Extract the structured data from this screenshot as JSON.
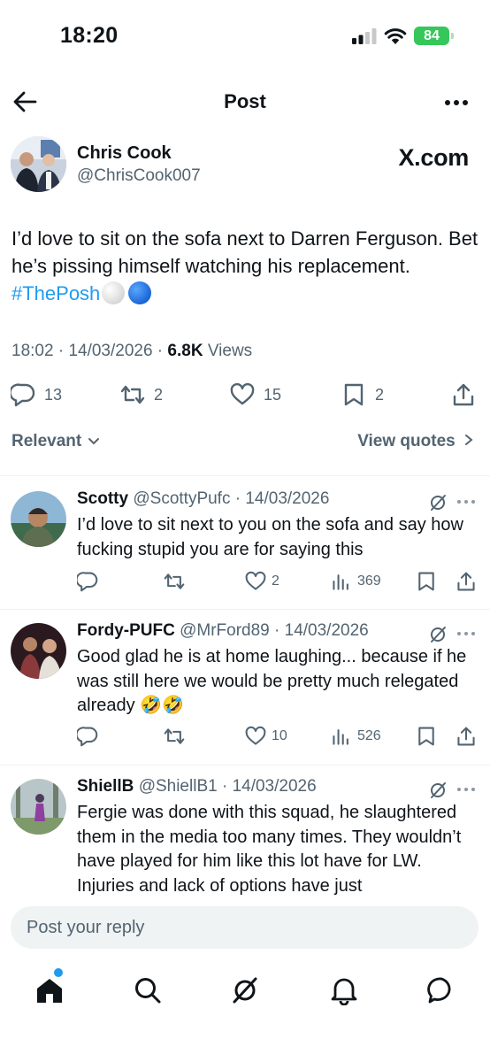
{
  "status_bar": {
    "time": "18:20",
    "battery": "84"
  },
  "header": {
    "title": "Post"
  },
  "post": {
    "author_name": "Chris Cook",
    "author_handle": "@ChrisCook007",
    "brand": "X.com",
    "text_main": "I’d love to sit on the sofa next to Darren Ferguson. Bet he’s pissing himself watching his replacement. ",
    "hashtag": "#ThePosh",
    "time": "18:02",
    "date": "14/03/2026",
    "views_count": "6.8K",
    "views_label": "Views",
    "replies": "13",
    "reposts": "2",
    "likes": "15",
    "bookmarks": "2"
  },
  "filter": {
    "sort_label": "Relevant",
    "quotes_label": "View quotes"
  },
  "replies": [
    {
      "name": "Scotty",
      "handle_date": "@ScottyPufc · 14/03/2026",
      "text": "I’d love to sit next to you on the sofa and say how fucking stupid you are for saying this",
      "replies": "",
      "reposts": "",
      "likes": "2",
      "views": "369"
    },
    {
      "name": "Fordy-PUFC",
      "handle_date": "@MrFord89 · 14/03/2026",
      "text": "Good glad he is at home laughing... because if he was still here we would be pretty much relegated already 🤣🤣",
      "replies": "",
      "reposts": "",
      "likes": "10",
      "views": "526"
    },
    {
      "name": "ShiellB",
      "handle_date": "@ShiellB1 · 14/03/2026",
      "text": "Fergie was done with this squad, he slaughtered them in the media too many times. They wouldn’t have played for him like this lot have for LW. Injuries and lack of options have just",
      "replies": "",
      "reposts": "",
      "likes": "",
      "views": ""
    }
  ],
  "reply_bar": {
    "placeholder": "Post your reply"
  },
  "colors": {
    "accent": "#1d9bf0",
    "text": "#0f1419",
    "secondary": "#536471",
    "battery": "#35c759"
  },
  "icons": [
    "back-arrow-icon",
    "more-icon",
    "reply-icon",
    "repost-icon",
    "like-icon",
    "bookmark-icon",
    "share-icon",
    "views-icon",
    "grok-icon",
    "home-icon",
    "search-icon",
    "bell-icon",
    "messages-icon"
  ]
}
